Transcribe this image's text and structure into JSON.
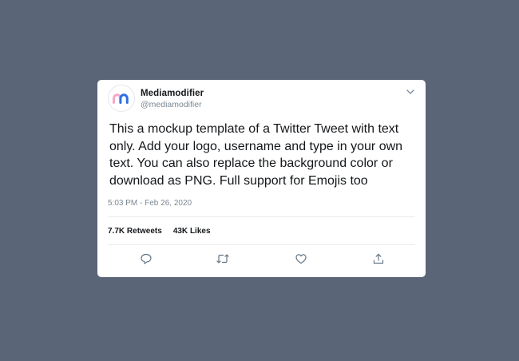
{
  "tweet": {
    "display_name": "Mediamodifier",
    "handle": "@mediamodifier",
    "text": "This a mockup template of a Twitter Tweet with text only. Add your logo, username and type in your own text. You can also replace the background color or download as PNG. Full support for Emojis too",
    "timestamp": "5:03 PM - Feb 26, 2020",
    "retweets_count": "7.7K",
    "retweets_label": "Retweets",
    "likes_count": "43K",
    "likes_label": "Likes"
  },
  "icons": {
    "avatar_logo": "mediamodifier-m-logo",
    "menu": "chevron-down-icon",
    "reply": "reply-icon",
    "retweet": "retweet-icon",
    "like": "heart-icon",
    "share": "share-icon"
  },
  "colors": {
    "background": "#5a6577",
    "card": "#ffffff",
    "text_primary": "#14171a",
    "text_secondary": "#7b8893",
    "icon": "#657786",
    "logo_pink": "#f7a8c8",
    "logo_blue": "#2f6fe0"
  }
}
